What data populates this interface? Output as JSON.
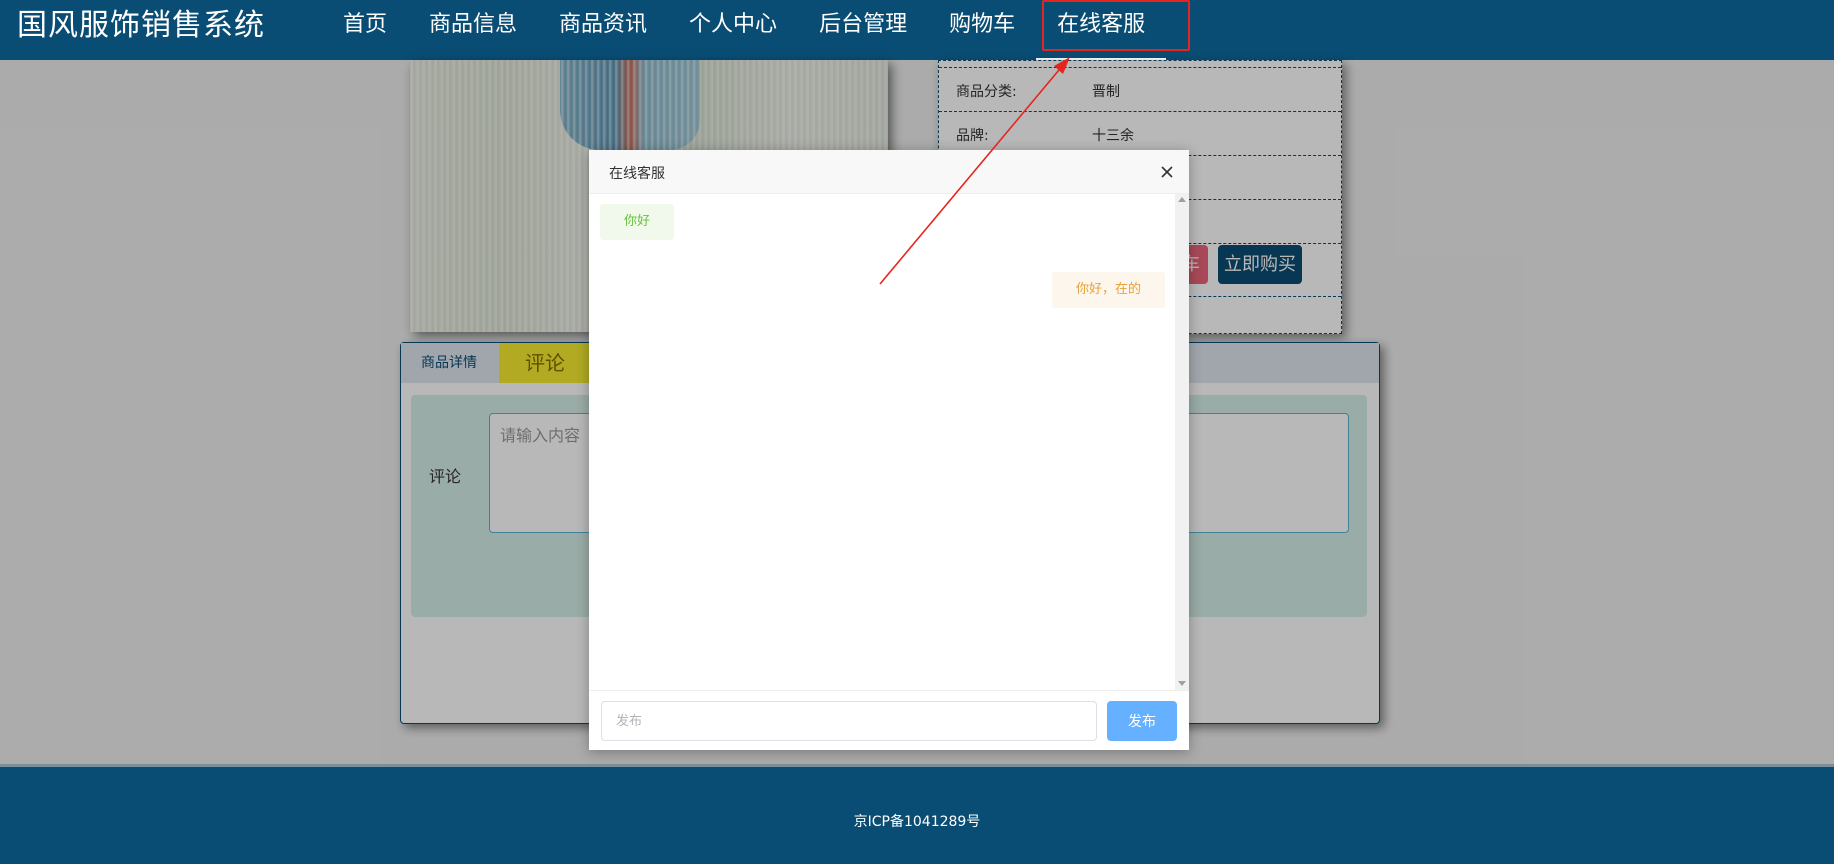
{
  "app": {
    "brand": "国风服饰销售系统"
  },
  "nav": {
    "items": [
      {
        "label": "首页"
      },
      {
        "label": "商品信息"
      },
      {
        "label": "商品资讯"
      },
      {
        "label": "个人中心"
      },
      {
        "label": "后台管理"
      },
      {
        "label": "购物车"
      },
      {
        "label": "在线客服"
      }
    ]
  },
  "product": {
    "rows": [
      {
        "label": "商品分类:",
        "value": "晋制"
      },
      {
        "label": "品牌:",
        "value": "十三余"
      }
    ],
    "cart_button_partial": "车",
    "buy_button": "立即购买"
  },
  "tabs": {
    "detail": "商品详情",
    "comment": "评论",
    "comment_label": "评论",
    "comment_placeholder": "请输入内容"
  },
  "chat_modal": {
    "title": "在线客服",
    "messages": [
      {
        "side": "left",
        "text": "你好"
      },
      {
        "side": "right",
        "text": "你好，在的"
      }
    ],
    "input_placeholder": "发布",
    "send_button": "发布"
  },
  "footer": {
    "icp": "京ICP备1041289号"
  },
  "colors": {
    "primary": "#0a4d74",
    "highlight_border": "#e5261f",
    "send_button": "#66b1ff",
    "user_message_bg": "#f0f9eb",
    "user_message_text": "#67c23a",
    "service_message_bg": "#fdf6ec",
    "service_message_text": "#e6a23c"
  }
}
